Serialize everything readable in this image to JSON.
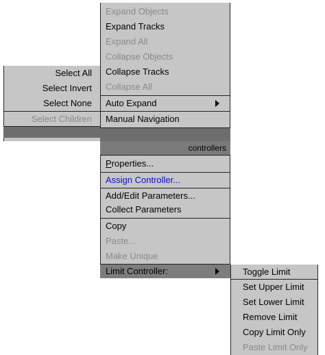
{
  "expand_menu": {
    "items": [
      {
        "label": "Expand Objects",
        "enabled": false
      },
      {
        "label": "Expand Tracks",
        "enabled": true
      },
      {
        "label": "Expand All",
        "enabled": false
      },
      {
        "label": "Collapse Objects",
        "enabled": false
      },
      {
        "label": "Collapse Tracks",
        "enabled": true
      },
      {
        "label": "Collapse All",
        "enabled": false
      },
      {
        "label": "Auto Expand",
        "enabled": true,
        "submenu": true
      },
      {
        "label": "Manual Navigation",
        "enabled": true
      }
    ]
  },
  "select_menu": {
    "items": [
      {
        "label": "Select All",
        "enabled": true
      },
      {
        "label": "Select Invert",
        "enabled": true
      },
      {
        "label": "Select None",
        "enabled": true
      },
      {
        "label": "Select Children",
        "enabled": false
      }
    ]
  },
  "controllers_menu": {
    "header": "controllers",
    "items": [
      {
        "label": "Properties...",
        "underline": "P",
        "label_rest": "roperties...",
        "enabled": true
      },
      {
        "label": "Assign Controller...",
        "enabled": true,
        "highlight_color": "#1010c8"
      },
      {
        "label": "Add/Edit Parameters...",
        "enabled": true
      },
      {
        "label": "Collect Parameters",
        "enabled": true
      },
      {
        "label": "Copy",
        "enabled": true
      },
      {
        "label": "Paste...",
        "enabled": false
      },
      {
        "label": "Make Unique",
        "enabled": false
      },
      {
        "label": "Limit Controller:",
        "enabled": true,
        "submenu": true,
        "active": true
      }
    ]
  },
  "limit_menu": {
    "items": [
      {
        "label": "Toggle Limit",
        "enabled": true
      },
      {
        "label": "Set Upper Limit",
        "enabled": true
      },
      {
        "label": "Set Lower Limit",
        "enabled": true
      },
      {
        "label": "Remove Limit",
        "enabled": true
      },
      {
        "label": "Copy Limit Only",
        "enabled": true
      },
      {
        "label": "Paste Limit Only",
        "enabled": false
      }
    ]
  },
  "colors": {
    "menu_bg": "#c6c6c6",
    "disabled_text": "#8a8a8a",
    "active_bg": "#7d7d7d",
    "link_text": "#1010c8"
  },
  "icons": {
    "submenu_arrow": "triangle-right-icon"
  }
}
